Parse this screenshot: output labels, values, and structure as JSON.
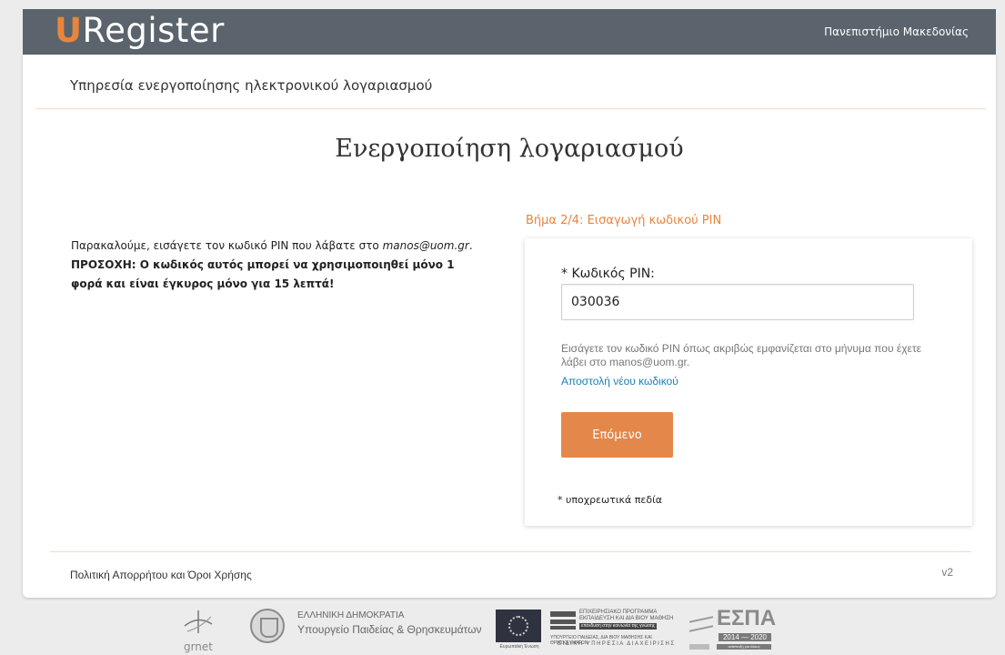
{
  "header": {
    "logo_initial": "U",
    "logo_rest": "Register",
    "university": "Πανεπιστήμιο Μακεδονίας"
  },
  "page": {
    "subtitle": "Υπηρεσία ενεργοποίησης ηλεκτρονικού λογαριασμού",
    "title": "Ενεργοποίηση λογαριασμού"
  },
  "info": {
    "text_before": "Παρακαλούμε, εισάγετε τον κωδικό PIN που λάβατε στο ",
    "email": "manos@uom.gr",
    "text_after": ". ",
    "warning": "ΠΡΟΣΟΧΗ: Ο κωδικός αυτός μπορεί να χρησιμοποιηθεί μόνο 1 φορά και είναι έγκυρος μόνο για 15 λεπτά!"
  },
  "form": {
    "step": "Βήμα 2/4: Εισαγωγή κωδικού PIN",
    "pin_label": "* Κωδικός PIN:",
    "pin_value": "030036",
    "hint": "Εισάγετε τον κωδικό PIN όπως ακριβώς εμφανίζεται στο μήνυμα που έχετε λάβει στο manos@uom.gr.",
    "resend_link": "Αποστολή νέου κωδικού",
    "next_button": "Επόμενο",
    "required_note": "* υποχρεωτικά πεδία"
  },
  "footer": {
    "policy_link": "Πολιτική Απορρήτου και Όροι Χρήσης",
    "version": "v2"
  },
  "logos": {
    "grnet": "grnet",
    "gov_line1": "ΕΛΛΗΝΙΚΗ ΔΗΜΟΚΡΑΤΙΑ",
    "gov_line2": "Υπουργείο Παιδείας & Θρησκευμάτων",
    "eu": "Ευρωπαϊκή Ένωση",
    "epan_line1": "ΕΠΙΧΕΙΡΗΣΙΑΚΟ ΠΡΟΓΡΑΜΜΑ ΕΚΠΑΙΔΕΥΣΗ ΚΑΙ ΔΙΑ ΒΙΟΥ ΜΑΘΗΣΗ",
    "epan_line2": "επένδυση στην κοινωνία της γνώσης",
    "epan_line3": "ΥΠΟΥΡΓΕΙΟ ΠΑΙΔΕΙΑΣ, ΔΙΑ ΒΙΟΥ ΜΑΘΗΣΗΣ ΚΑΙ ΘΡΗΣΚΕΥΜΑΤΩΝ",
    "epan_line4": "ΕΙΔΙΚΗ ΥΠΗΡΕΣΙΑ ΔΙΑΧΕΙΡΙΣΗΣ",
    "espa": "ΕΣΠΑ",
    "espa_years": "2014 — 2020",
    "espa_tag": "ανάπτυξη για όλους"
  },
  "colors": {
    "accent": "#e4874a",
    "topbar": "#5b646c",
    "link": "#1a7fb5"
  }
}
